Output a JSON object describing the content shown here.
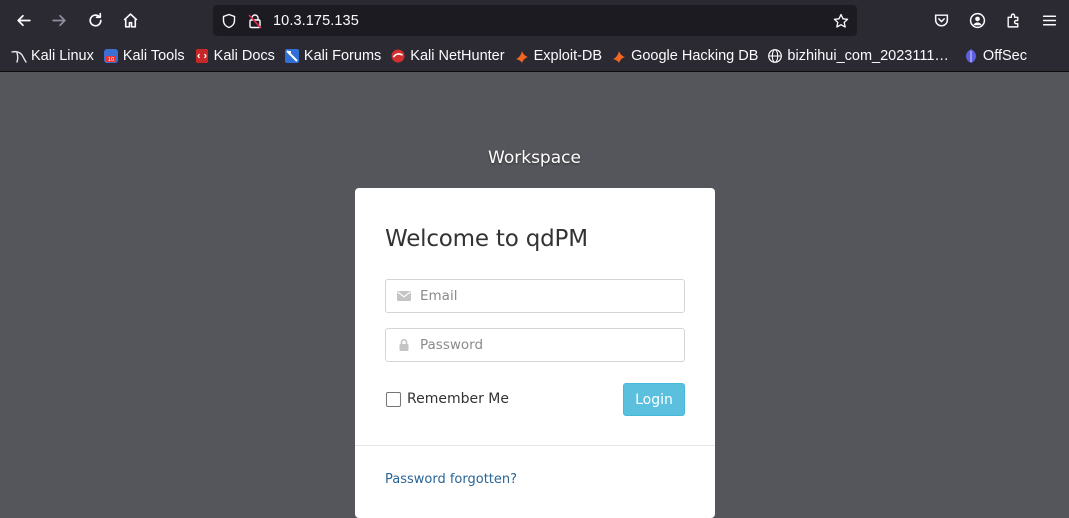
{
  "browser": {
    "url": "10.3.175.135",
    "bookmarks": [
      {
        "label": "Kali Linux",
        "icon": "kali-dragon-icon"
      },
      {
        "label": "Kali Tools",
        "icon": "kali-tools-icon"
      },
      {
        "label": "Kali Docs",
        "icon": "kali-docs-icon"
      },
      {
        "label": "Kali Forums",
        "icon": "kali-forums-icon"
      },
      {
        "label": "Kali NetHunter",
        "icon": "kali-nethunter-icon"
      },
      {
        "label": "Exploit-DB",
        "icon": "exploit-db-icon"
      },
      {
        "label": "Google Hacking DB",
        "icon": "ghdb-icon"
      },
      {
        "label": "bizhihui_com_2023111…",
        "icon": "globe-icon"
      },
      {
        "label": "OffSec",
        "icon": "offsec-icon"
      }
    ]
  },
  "page": {
    "workspace_title": "Workspace",
    "heading": "Welcome to qdPM",
    "email_placeholder": "Email",
    "password_placeholder": "Password",
    "remember_label": "Remember Me",
    "login_label": "Login",
    "forgot_label": "Password forgotten?"
  },
  "colors": {
    "page_background": "#55565b",
    "chrome_background": "#2b2a33",
    "login_button": "#5bc0de",
    "link": "#2a6496"
  }
}
